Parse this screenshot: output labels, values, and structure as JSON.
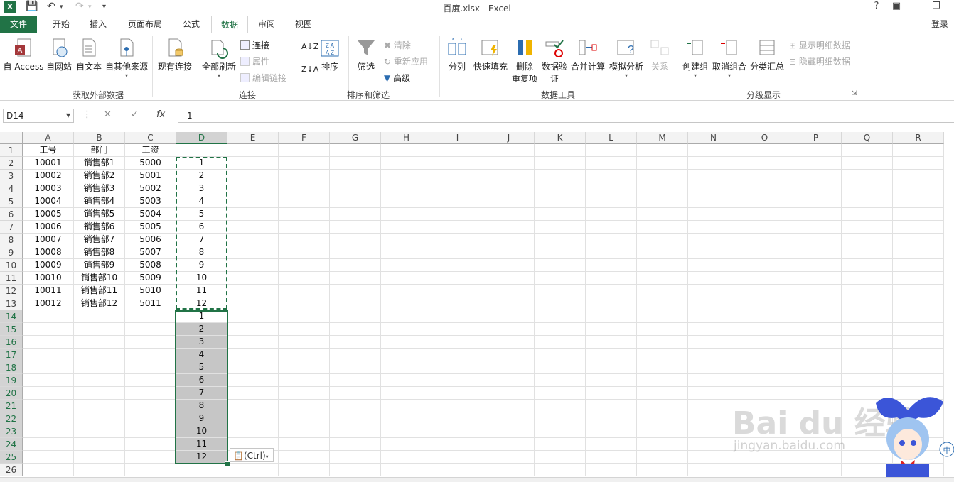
{
  "window": {
    "title": "百度.xlsx - Excel",
    "help": "?",
    "login": "登录"
  },
  "tabs": [
    "文件",
    "开始",
    "插入",
    "页面布局",
    "公式",
    "数据",
    "审阅",
    "视图"
  ],
  "active_tab": "数据",
  "ribbon": {
    "get_external": {
      "label": "获取外部数据",
      "buttons": [
        "自 Access",
        "自网站",
        "自文本",
        "自其他来源",
        "现有连接"
      ]
    },
    "connections": {
      "label": "连接",
      "refresh_all": "全部刷新",
      "connections": "连接",
      "properties": "属性",
      "edit_links": "编辑链接"
    },
    "sort_filter": {
      "label": "排序和筛选",
      "sort": "排序",
      "filter": "筛选",
      "clear": "清除",
      "reapply": "重新应用",
      "advanced": "高级"
    },
    "data_tools": {
      "label": "数据工具",
      "split": "分列",
      "flash_fill": "快速填充",
      "remove_dup_1": "删除",
      "remove_dup_2": "重复项",
      "validation_1": "数据验",
      "validation_2": "证",
      "consolidate": "合并计算",
      "what_if": "模拟分析",
      "relations": "关系"
    },
    "outline": {
      "label": "分级显示",
      "group": "创建组",
      "ungroup": "取消组合",
      "subtotal": "分类汇总",
      "show_detail": "显示明细数据",
      "hide_detail": "隐藏明细数据"
    }
  },
  "formula_bar": {
    "name_box": "D14",
    "value": "1"
  },
  "columns": [
    "A",
    "B",
    "C",
    "D",
    "E",
    "F",
    "G",
    "H",
    "I",
    "J",
    "K",
    "L",
    "M",
    "N",
    "O",
    "P",
    "Q",
    "R"
  ],
  "rows": [
    "1",
    "2",
    "3",
    "4",
    "5",
    "6",
    "7",
    "8",
    "9",
    "10",
    "11",
    "12",
    "13",
    "14",
    "15",
    "16",
    "17",
    "18",
    "19",
    "20",
    "21",
    "22",
    "23",
    "24",
    "25",
    "26"
  ],
  "table": [
    [
      "工号",
      "部门",
      "工资",
      ""
    ],
    [
      "10001",
      "销售部1",
      "5000",
      "1"
    ],
    [
      "10002",
      "销售部2",
      "5001",
      "2"
    ],
    [
      "10003",
      "销售部3",
      "5002",
      "3"
    ],
    [
      "10004",
      "销售部4",
      "5003",
      "4"
    ],
    [
      "10005",
      "销售部5",
      "5004",
      "5"
    ],
    [
      "10006",
      "销售部6",
      "5005",
      "6"
    ],
    [
      "10007",
      "销售部7",
      "5006",
      "7"
    ],
    [
      "10008",
      "销售部8",
      "5007",
      "8"
    ],
    [
      "10009",
      "销售部9",
      "5008",
      "9"
    ],
    [
      "10010",
      "销售部10",
      "5009",
      "10"
    ],
    [
      "10011",
      "销售部11",
      "5010",
      "11"
    ],
    [
      "10012",
      "销售部12",
      "5011",
      "12"
    ]
  ],
  "pasted": [
    "1",
    "2",
    "3",
    "4",
    "5",
    "6",
    "7",
    "8",
    "9",
    "10",
    "11",
    "12"
  ],
  "paste_options": "(Ctrl)",
  "watermark": {
    "big": "Bai du 经验",
    "small": "jingyan.baidu.com"
  },
  "colors": {
    "accent": "#217346"
  }
}
